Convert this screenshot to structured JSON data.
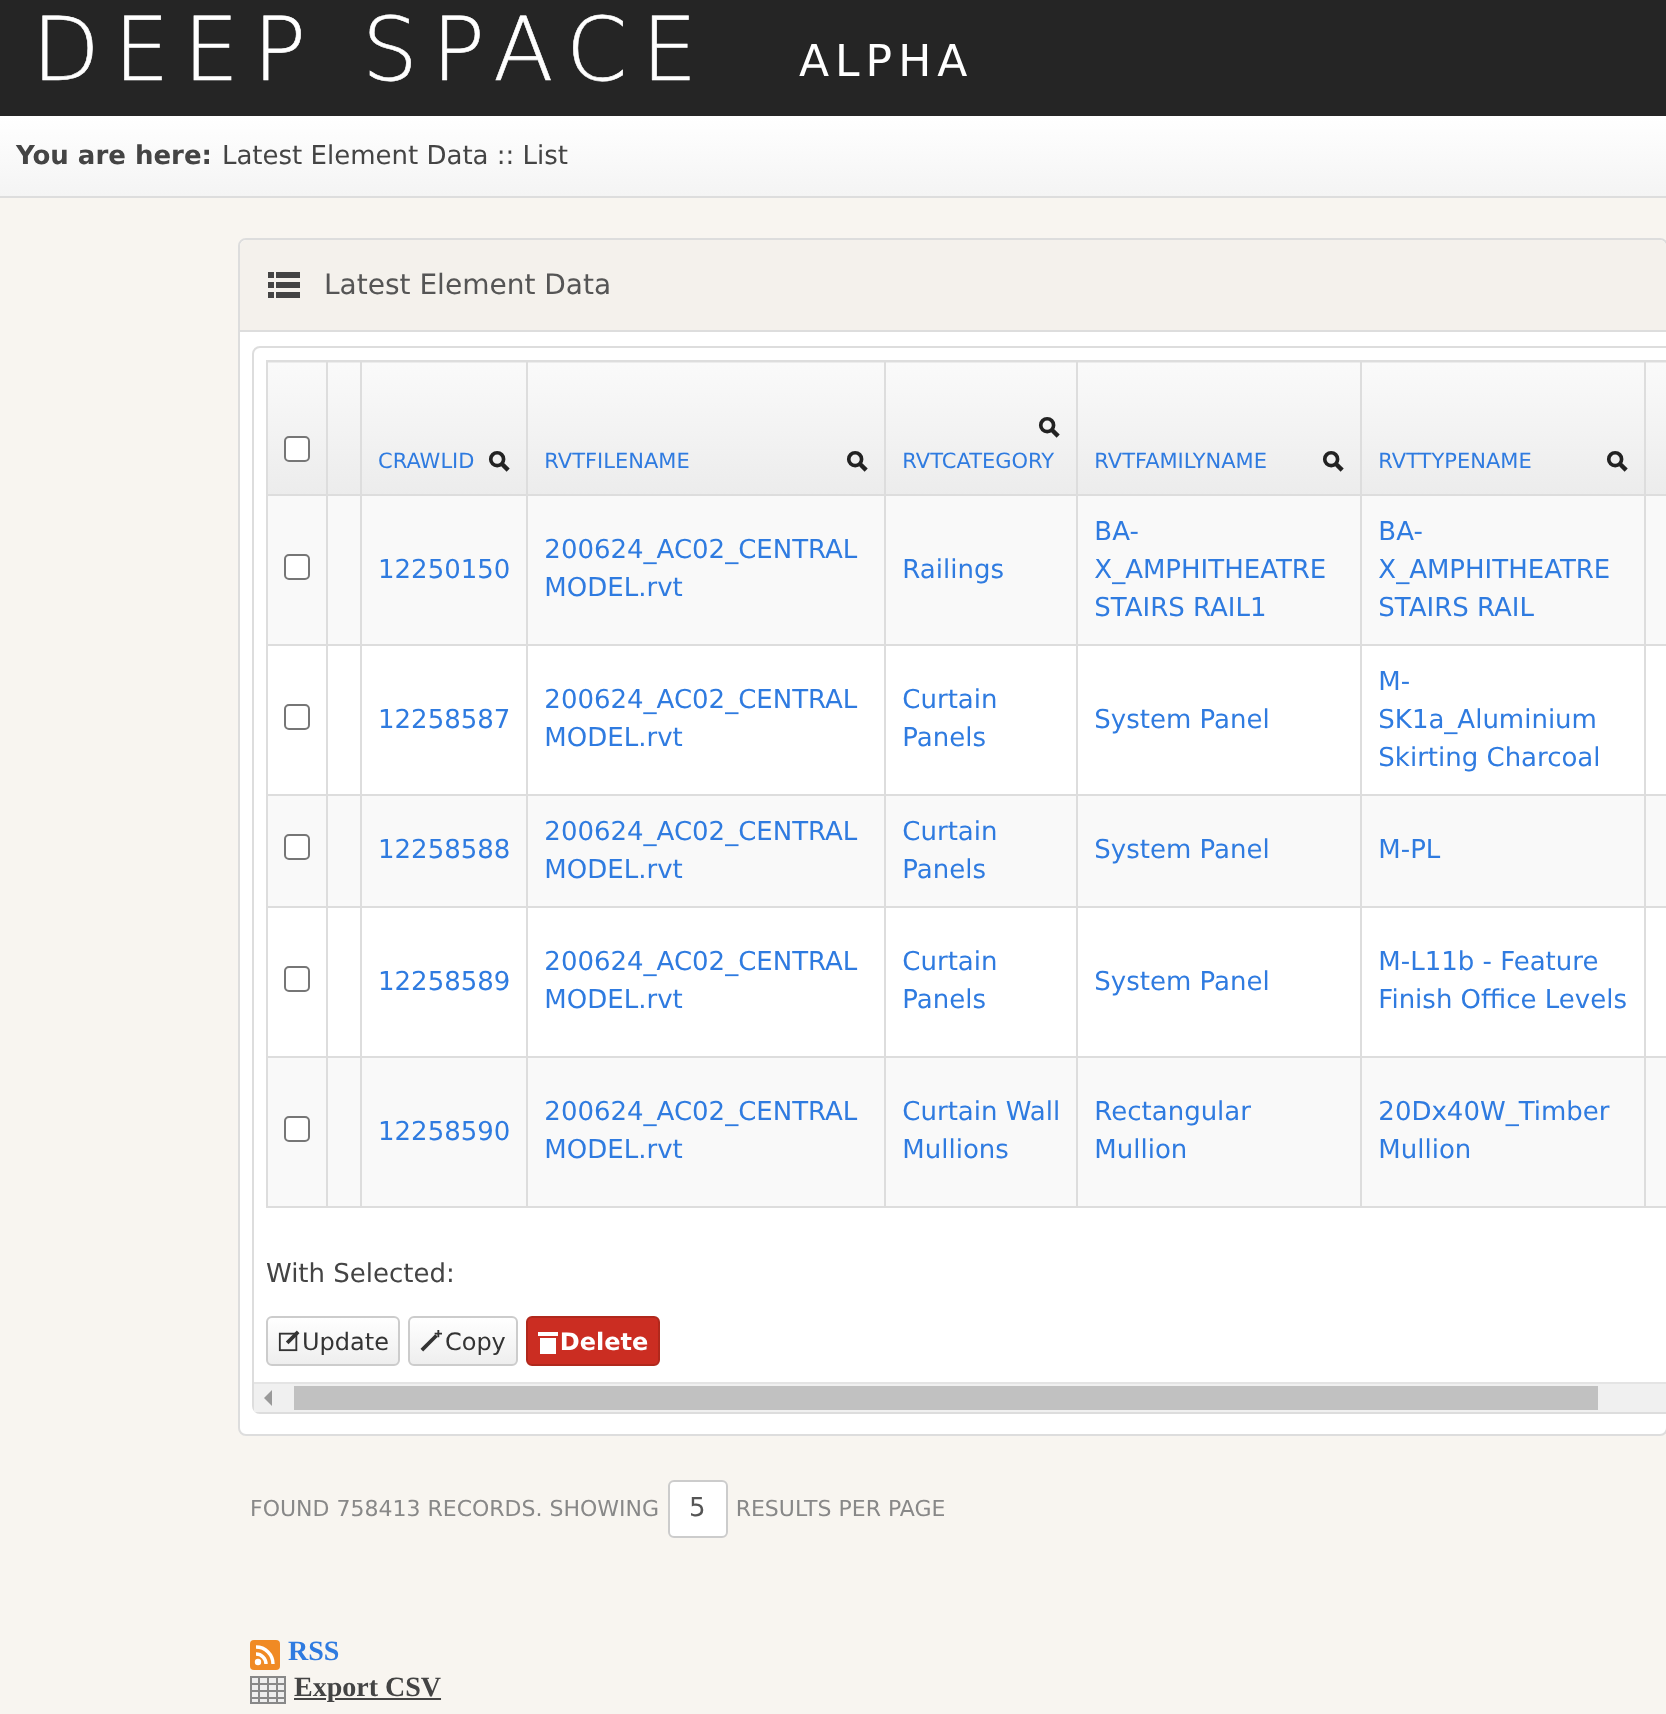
{
  "header": {
    "logo": "DEEP SPACE",
    "edition": "ALPHA"
  },
  "breadcrumb": {
    "label": "You are here:",
    "path": "Latest Element Data :: List"
  },
  "panel": {
    "title": "Latest Element Data"
  },
  "table": {
    "select_all": {
      "checked": false
    },
    "columns": [
      {
        "label": "CRAWLID"
      },
      {
        "label": "RVTFILENAME"
      },
      {
        "label": "RVTCATEGORY"
      },
      {
        "label": "RVTFAMILYNAME"
      },
      {
        "label": "RVTTYPENAME"
      }
    ],
    "rows": [
      {
        "checked": false,
        "cells": [
          "12250150",
          "200624_AC02_CENTRAL MODEL.rvt",
          "Railings",
          "BA-X_AMPHITHEATRE STAIRS RAIL1",
          "BA-X_AMPHITHEATRE STAIRS RAIL"
        ]
      },
      {
        "checked": false,
        "cells": [
          "12258587",
          "200624_AC02_CENTRAL MODEL.rvt",
          "Curtain Panels",
          "System Panel",
          "M-SK1a_Aluminium Skirting Charcoal"
        ]
      },
      {
        "checked": false,
        "cells": [
          "12258588",
          "200624_AC02_CENTRAL MODEL.rvt",
          "Curtain Panels",
          "System Panel",
          "M-PL"
        ]
      },
      {
        "checked": false,
        "cells": [
          "12258589",
          "200624_AC02_CENTRAL MODEL.rvt",
          "Curtain Panels",
          "System Panel",
          "M-L11b - Feature Finish Office Levels"
        ]
      },
      {
        "checked": false,
        "cells": [
          "12258590",
          "200624_AC02_CENTRAL MODEL.rvt",
          "Curtain Wall Mullions",
          "Rectangular Mullion",
          "20Dx40W_Timber Mullion"
        ]
      }
    ]
  },
  "bulk": {
    "label": "With Selected:",
    "actions": [
      {
        "kind": "update",
        "label": "Update"
      },
      {
        "kind": "copy",
        "label": "Copy"
      },
      {
        "kind": "delete",
        "label": "Delete"
      }
    ]
  },
  "paging": {
    "before": "FOUND 758413 RECORDS. SHOWING",
    "per_page": "5",
    "after": "RESULTS PER PAGE"
  },
  "links": [
    {
      "kind": "rss",
      "label": "RSS"
    },
    {
      "kind": "csv",
      "label": "Export CSV"
    }
  ]
}
